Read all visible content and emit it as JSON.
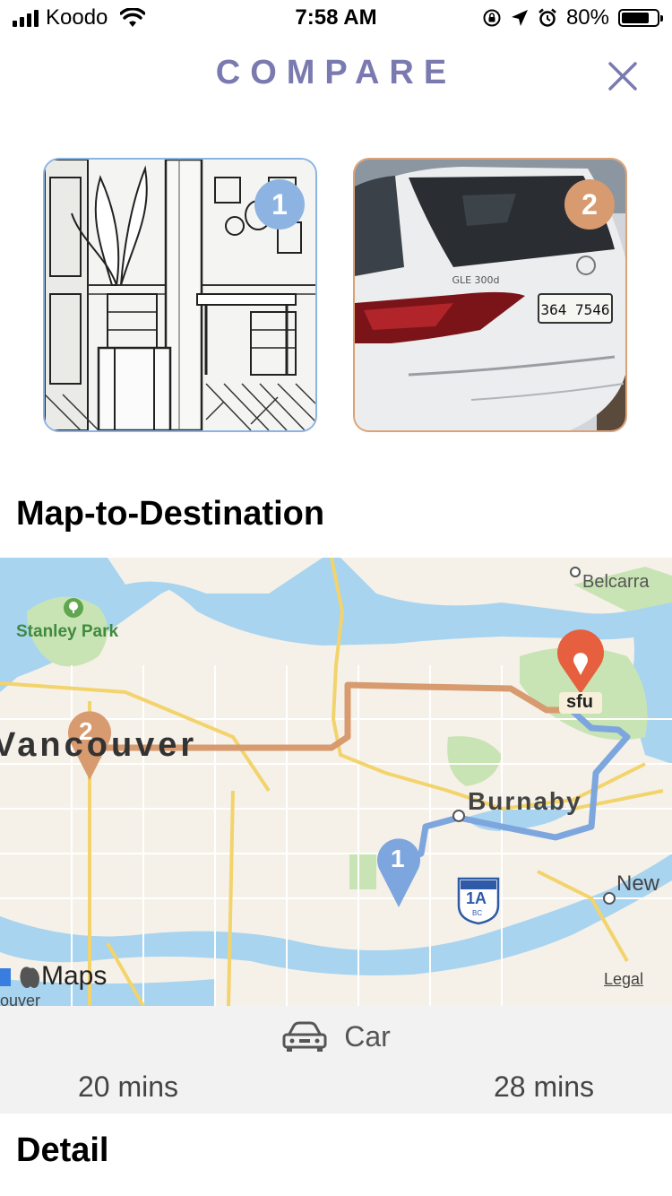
{
  "status_bar": {
    "carrier": "Koodo",
    "time": "7:58 AM",
    "battery_percent": "80%",
    "battery_level": 0.8,
    "icons": [
      "signal-icon",
      "wifi-icon",
      "orientation-lock-icon",
      "location-arrow-icon",
      "alarm-icon",
      "battery-icon"
    ]
  },
  "header": {
    "title": "COMPARE",
    "close_icon": "close-icon",
    "accent_color": "#7a7ab0"
  },
  "places": [
    {
      "number": "1",
      "color": "#8db3e2"
    },
    {
      "number": "2",
      "color": "#d89a6f"
    }
  ],
  "map_section": {
    "title": "Map-to-Destination",
    "labels": {
      "belcarra": "Belcarra",
      "stanley_park": "Stanley Park",
      "vancouver": "Vancouver",
      "sfu": "sfu",
      "burnaby": "Burnaby",
      "new_west": "New",
      "highway_shield": "1A",
      "shield_sub": "BC",
      "maps_brand": "Maps",
      "legal": "Legal",
      "couver_fragment": "ouver"
    },
    "pin_numbers": [
      "1",
      "2"
    ]
  },
  "transport": {
    "mode_label": "Car",
    "mode_icon": "car-icon",
    "time_place_1": "20 mins",
    "time_place_2": "28 mins"
  },
  "detail_section": {
    "title": "Detail"
  }
}
